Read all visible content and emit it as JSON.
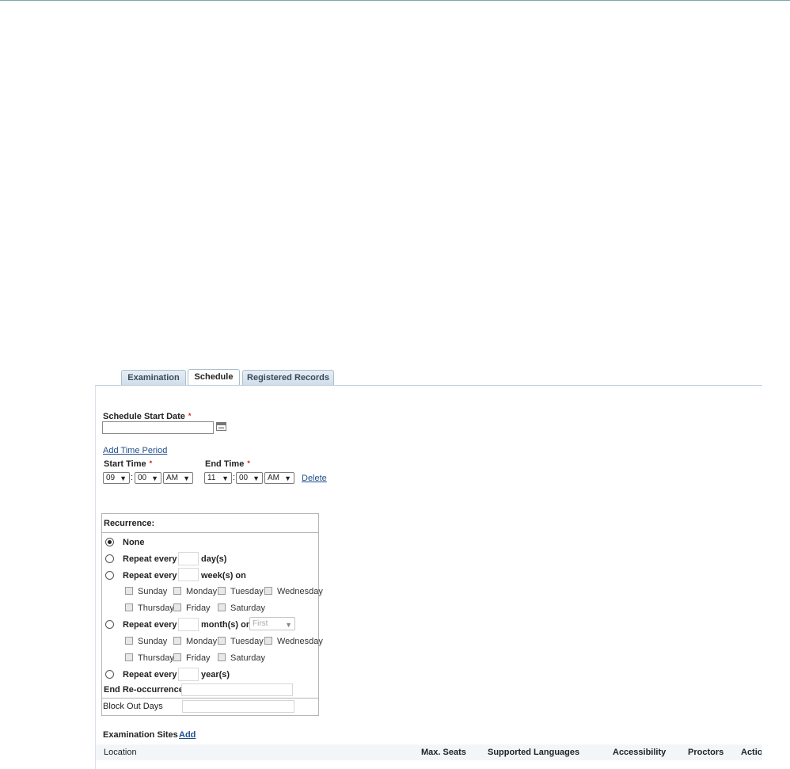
{
  "tabs": [
    {
      "label": "Examination"
    },
    {
      "label": "Schedule"
    },
    {
      "label": "Registered Records"
    }
  ],
  "schedule": {
    "start_date_label": "Schedule Start Date",
    "required_mark": "*",
    "start_date_value": "",
    "add_time_period": "Add Time Period",
    "start_time_label": "Start Time",
    "end_time_label": "End Time",
    "start_hour": "09",
    "start_minute": "00",
    "start_ampm": "AM",
    "end_hour": "11",
    "end_minute": "00",
    "end_ampm": "AM",
    "colon": ":",
    "delete_label": "Delete"
  },
  "recurrence": {
    "title": "Recurrence:",
    "none_label": "None",
    "repeat_every": "Repeat every",
    "days_unit": "day(s)",
    "weeks_unit": "week(s) on",
    "months_unit": "month(s) on",
    "years_unit": "year(s)",
    "month_select": "First",
    "weekdays": [
      "Sunday",
      "Monday",
      "Tuesday",
      "Wednesday",
      "Thursday",
      "Friday",
      "Saturday"
    ],
    "end_reoccurrence_label": "End Re-occurrence",
    "block_out_days_label": "Block Out Days"
  },
  "exam_sites": {
    "title": "Examination Sites",
    "add_label": "Add",
    "columns": [
      "Location",
      "Max. Seats",
      "Supported Languages",
      "Accessibility",
      "Proctors",
      "Actio"
    ]
  }
}
